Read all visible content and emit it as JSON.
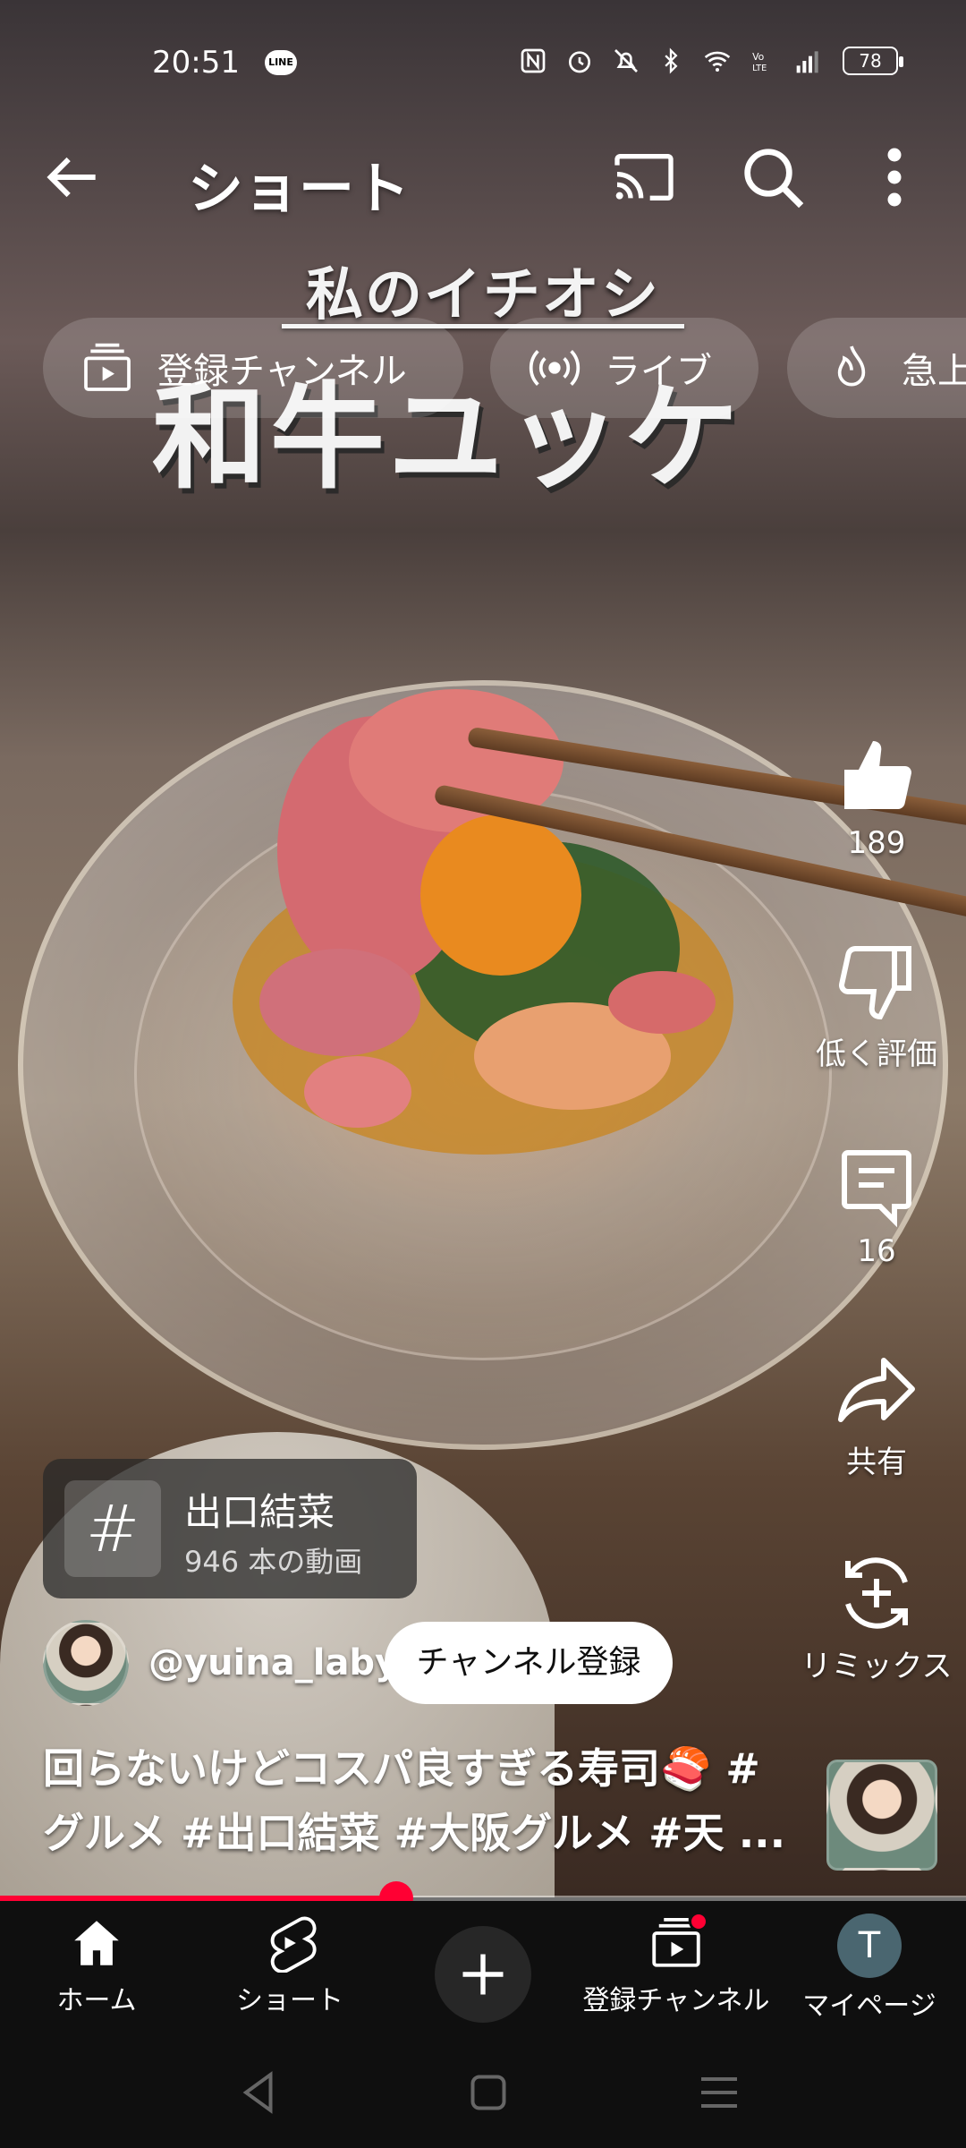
{
  "status_bar": {
    "time": "20:51",
    "line_badge": "LINE",
    "battery": "78"
  },
  "header": {
    "title": "ショート"
  },
  "chips": [
    {
      "label": "登録チャンネル",
      "icon": "subscriptions-icon"
    },
    {
      "label": "ライブ",
      "icon": "live-icon"
    },
    {
      "label": "急上",
      "icon": "trending-icon"
    }
  ],
  "video_overlay": {
    "subtitle": "私のイチオシ",
    "title": "和牛ユッケ"
  },
  "actions": {
    "like_count": "189",
    "dislike_label": "低く評価",
    "comment_count": "16",
    "share_label": "共有",
    "remix_label": "リミックス"
  },
  "hashtag_card": {
    "symbol": "#",
    "name": "出口結菜",
    "count": "946 本の動画"
  },
  "channel": {
    "handle": "@yuina_laby",
    "subscribe_label": "チャンネル登録"
  },
  "caption": "回らないけどコスパ良すぎる寿司🍣 #グルメ #出口結菜 #大阪グルメ #天 ...",
  "progress": {
    "played_fraction": 0.41
  },
  "bottom_nav": [
    {
      "label": "ホーム",
      "icon": "home-icon"
    },
    {
      "label": "ショート",
      "icon": "shorts-icon"
    },
    {
      "label": "",
      "icon": "create-icon"
    },
    {
      "label": "登録チャンネル",
      "icon": "subscriptions-icon"
    },
    {
      "label": "マイページ",
      "icon": "avatar"
    }
  ],
  "my_avatar_letter": "T",
  "colors": {
    "accent": "#ff0033",
    "nav_bg": "#0f0f0f"
  }
}
